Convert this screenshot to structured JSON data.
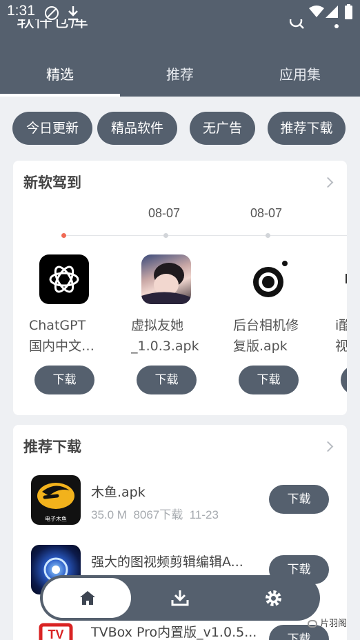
{
  "status_bar": {
    "time": "1:31"
  },
  "header": {
    "title": "软件仓库"
  },
  "tabs": [
    {
      "label": "精选",
      "active": true
    },
    {
      "label": "推荐",
      "active": false
    },
    {
      "label": "应用集",
      "active": false
    }
  ],
  "chips": [
    "今日更新",
    "精品软件",
    "无广告",
    "推荐下载"
  ],
  "new_section": {
    "title": "新软驾到",
    "dates": [
      "08-07",
      "08-07"
    ],
    "apps": [
      {
        "name_line1": "ChatGPT",
        "name_line2": "国内中文…",
        "button": "下载",
        "icon": "chatgpt-icon"
      },
      {
        "name_line1": "虚拟友她",
        "name_line2": "_1.0.3.apk",
        "button": "下载",
        "icon": "girl-photo-icon"
      },
      {
        "name_line1": "后台相机修",
        "name_line2": "复版.apk",
        "button": "下载",
        "icon": "camera-icon"
      },
      {
        "name_line1": "i酷",
        "name_line2": "视",
        "button": "下载",
        "icon": "app-icon"
      }
    ]
  },
  "recommend_section": {
    "title": "推荐下载",
    "items": [
      {
        "name": "木鱼.apk",
        "size": "35.0 M",
        "downloads": "8067下载",
        "date": "11-23",
        "button": "下载",
        "icon": "wooden-fish-icon",
        "icon_caption": "电子木鱼"
      },
      {
        "name": "强大的图视频剪辑编辑A...",
        "button": "下载",
        "icon": "video-editor-icon"
      },
      {
        "name": "TVBox Pro内置版_v1.0.5...",
        "button": "下载",
        "icon": "tvbox-icon",
        "icon_caption": "TV"
      }
    ]
  },
  "bottom_nav": [
    {
      "icon": "home-icon",
      "active": true
    },
    {
      "icon": "download-icon",
      "active": false
    },
    {
      "icon": "settings-icon",
      "active": false
    }
  ],
  "watermark": "片羽阁",
  "colors": {
    "primary": "#55606e",
    "background": "#eef0f3",
    "card": "#ffffff",
    "timeline_active": "#f06a55"
  }
}
